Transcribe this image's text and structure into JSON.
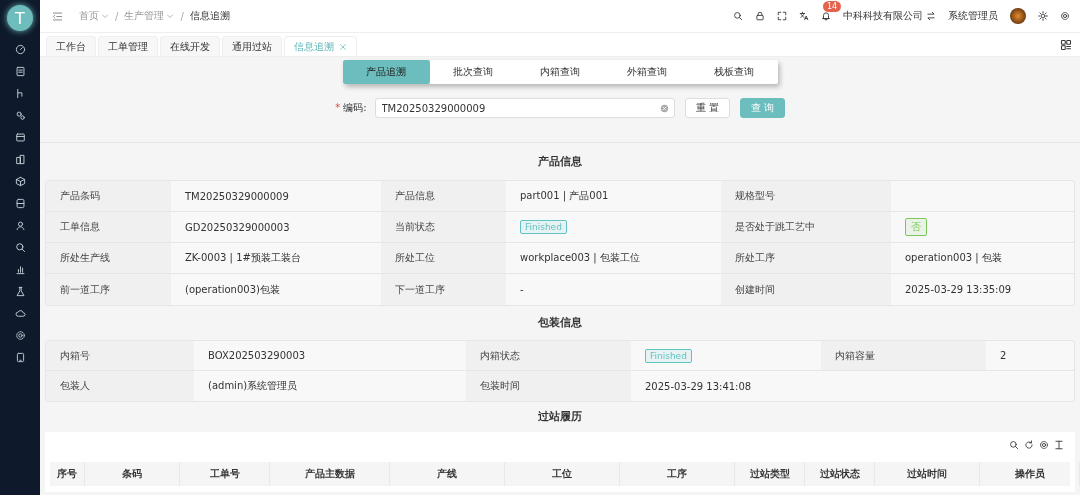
{
  "sidebar": {
    "logo": "T"
  },
  "header": {
    "breadcrumbs": [
      {
        "label": "首页",
        "dropdown": true
      },
      {
        "label": "生产管理",
        "dropdown": true
      },
      {
        "label": "信息追溯",
        "dropdown": false
      }
    ],
    "separator": "/",
    "notification_count": "14",
    "company": "中科科技有限公司",
    "user": "系统管理员"
  },
  "page_tabs": [
    {
      "label": "工作台",
      "selected": false,
      "closable": false
    },
    {
      "label": "工单管理",
      "selected": false,
      "closable": false
    },
    {
      "label": "在线开发",
      "selected": false,
      "closable": false
    },
    {
      "label": "通用过站",
      "selected": false,
      "closable": false
    },
    {
      "label": "信息追溯",
      "selected": true,
      "closable": true
    }
  ],
  "query_tabs": [
    {
      "label": "产品追溯",
      "selected": true
    },
    {
      "label": "批次查询",
      "selected": false
    },
    {
      "label": "内箱查询",
      "selected": false
    },
    {
      "label": "外箱查询",
      "selected": false
    },
    {
      "label": "栈板查询",
      "selected": false
    }
  ],
  "search": {
    "label": "编码:",
    "required_mark": "*",
    "value": "TM20250329000009"
  },
  "buttons": [
    {
      "label": "重 置",
      "kind": "default"
    },
    {
      "label": "查 询",
      "kind": "primary"
    }
  ],
  "product_info": {
    "title": "产品信息",
    "fields": [
      {
        "label": "产品条码",
        "value": "TM20250329000009",
        "kind": "text"
      },
      {
        "label": "产品信息",
        "value": "part001 | 产品001",
        "kind": "text"
      },
      {
        "label": "规格型号",
        "kind": "text"
      },
      {
        "label": "工单信息",
        "value": "GD20250329000003",
        "kind": "text"
      },
      {
        "label": "当前状态",
        "value": "Finished",
        "kind": "tag",
        "color": "#5ec4c4"
      },
      {
        "label": "是否处于跳工艺中",
        "value": "否",
        "kind": "tag",
        "color": "#7cc95a"
      },
      {
        "label": "所处生产线",
        "value": "ZK-0003 | 1#预装工装台",
        "kind": "text"
      },
      {
        "label": "所处工位",
        "value": "workplace003 | 包装工位",
        "kind": "text"
      },
      {
        "label": "所处工序",
        "value": "operation003 | 包装",
        "kind": "text"
      },
      {
        "label": "前一道工序",
        "value": "(operation003)包装",
        "kind": "text"
      },
      {
        "label": "下一道工序",
        "value": "-",
        "kind": "text"
      },
      {
        "label": "创建时间",
        "value": "2025-03-29 13:35:09",
        "kind": "text"
      }
    ]
  },
  "packaging_info": {
    "title": "包装信息",
    "fields": [
      {
        "label": "内箱号",
        "value": "BOX202503290003",
        "kind": "text"
      },
      {
        "label": "内箱状态",
        "value": "Finished",
        "kind": "tag",
        "color": "#5ec4c4"
      },
      {
        "label": "内箱容量",
        "value": "2",
        "kind": "text"
      },
      {
        "label": "包装人",
        "value": "(admin)系统管理员",
        "kind": "text"
      },
      {
        "label": "包装时间",
        "value": "2025-03-29 13:41:08",
        "kind": "text"
      }
    ]
  },
  "history": {
    "title": "过站履历",
    "columns": [
      "序号",
      "条码",
      "工单号",
      "产品主数据",
      "产线",
      "工位",
      "工序",
      "过站类型",
      "过站状态",
      "过站时间",
      "操作员"
    ]
  }
}
